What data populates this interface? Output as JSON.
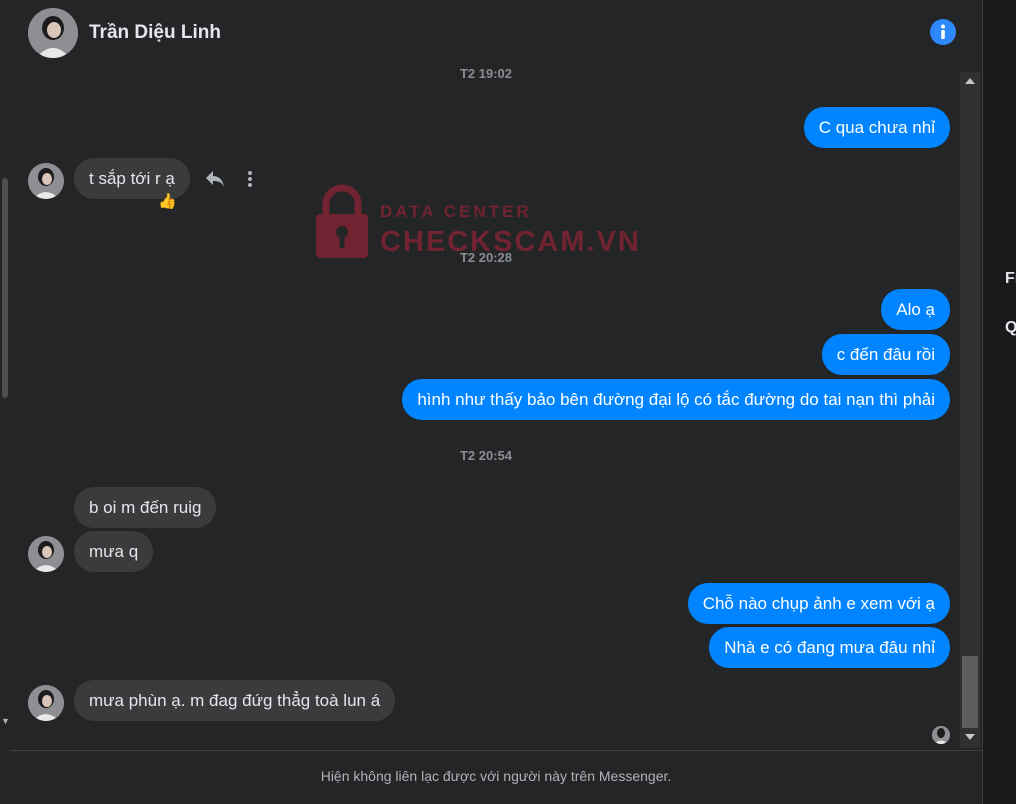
{
  "contact": {
    "name": "Trần Diệu Linh"
  },
  "icons": {
    "info": "info-icon",
    "reply": "reply-icon",
    "more": "more-vertical-icon",
    "lock": "lock-icon"
  },
  "colors": {
    "accent": "#0084ff",
    "incoming_bubble": "#3a3b3c",
    "background": "#242526",
    "watermark": "#b1233a"
  },
  "timestamps": [
    "T2 19:02",
    "T2 20:28",
    "T2 20:54"
  ],
  "messages": {
    "m1": "C qua chưa nhỉ",
    "m2": "t sắp tới r ạ",
    "m2_reaction": "👍",
    "m3": "Alo ạ",
    "m4": "c đến đâu rồi",
    "m5": "hình như thấy bảo bên đường đại lộ có tắc đường do tai nạn thì phải",
    "m6": "b oi m đến ruig",
    "m7": "mưa q",
    "m8": "Chỗ nào chụp ảnh e xem với ạ",
    "m9": "Nhà e có đang mưa đâu nhỉ",
    "m10": "mưa phùn ạ. m đag đứg thẳg toà lun á"
  },
  "watermark": {
    "line1": "DATA CENTER",
    "line2": "CHECKSCAM.VN"
  },
  "footer": {
    "notice": "Hiện không liên lạc được với người này trên Messenger."
  },
  "right_panel": {
    "letter1": "Fi",
    "letter2": "Q"
  }
}
